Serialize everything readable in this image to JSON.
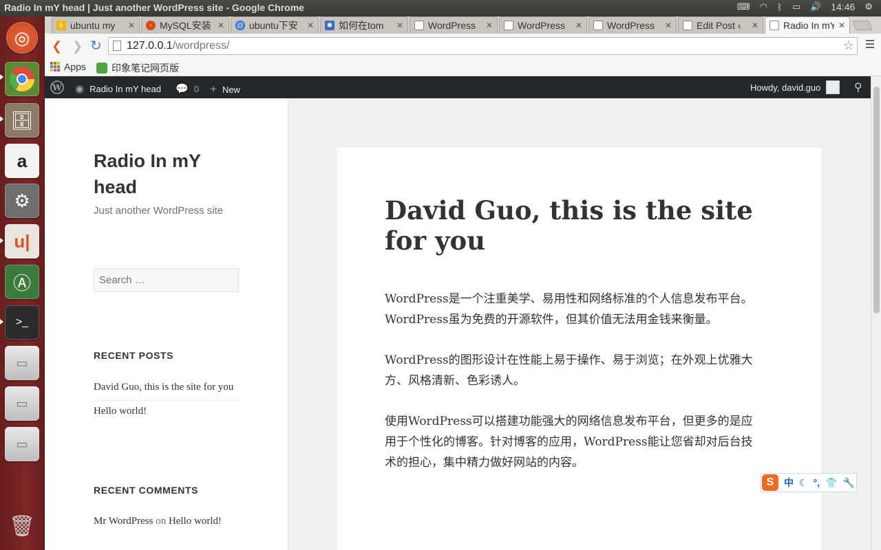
{
  "panel": {
    "window_title": "Radio In mY head | Just another WordPress site - Google Chrome",
    "clock": "14:46"
  },
  "launcher": {
    "items": [
      "ubuntu-dash",
      "chrome",
      "files",
      "amazon",
      "system-settings",
      "ubuntu-one",
      "software-updater",
      "terminal",
      "drive-1",
      "drive-2",
      "drive-3",
      "trash"
    ]
  },
  "browser": {
    "tabs": [
      {
        "label": "ubuntu my",
        "icon": "bing-icon"
      },
      {
        "label": "MySQL安装",
        "icon": "ubuntu-forum-icon"
      },
      {
        "label": "ubuntu下安",
        "icon": "baidu-icon"
      },
      {
        "label": "如何在tom",
        "icon": "site-icon"
      },
      {
        "label": "WordPress",
        "icon": "page-icon"
      },
      {
        "label": "WordPress",
        "icon": "page-icon"
      },
      {
        "label": "WordPress",
        "icon": "page-icon"
      },
      {
        "label": "Edit Post ‹",
        "icon": "page-icon"
      },
      {
        "label": "Radio In mY",
        "icon": "page-icon"
      }
    ],
    "url_host": "127.0.0.1",
    "url_path": "/wordpress/",
    "bookmarks": {
      "apps_label": "Apps",
      "evernote_label": "印象笔记网页版"
    }
  },
  "adminbar": {
    "site_name": "Radio In mY head",
    "comments_count": "0",
    "new_label": "New",
    "howdy": "Howdy, david.guo"
  },
  "sidebar": {
    "site_title": "Radio In mY head",
    "site_description": "Just another WordPress site",
    "search_placeholder": "Search …",
    "recent_posts_title": "RECENT POSTS",
    "recent_posts": [
      "David Guo, this is the site for you",
      "Hello world!"
    ],
    "recent_comments_title": "RECENT COMMENTS",
    "comment_author": "Mr WordPress",
    "comment_on": "on",
    "comment_post": "Hello world!"
  },
  "post": {
    "title": "David Guo, this is the site for you",
    "paragraphs": [
      "WordPress是一个注重美学、易用性和网络标准的个人信息发布平台。WordPress虽为免费的开源软件，但其价值无法用金钱来衡量。",
      "WordPress的图形设计在性能上易于操作、易于浏览；在外观上优雅大方、风格清新、色彩诱人。",
      "使用WordPress可以搭建功能强大的网络信息发布平台，但更多的是应用于个性化的博客。针对博客的应用，WordPress能让您省却对后台技术的担心，集中精力做好网站的内容。"
    ]
  },
  "ime": {
    "logo": "S",
    "mode": "中"
  },
  "colors": {
    "launcher_bg": "#7d2626",
    "adminbar_bg": "#23282d",
    "sogou_orange": "#f06b1f"
  }
}
